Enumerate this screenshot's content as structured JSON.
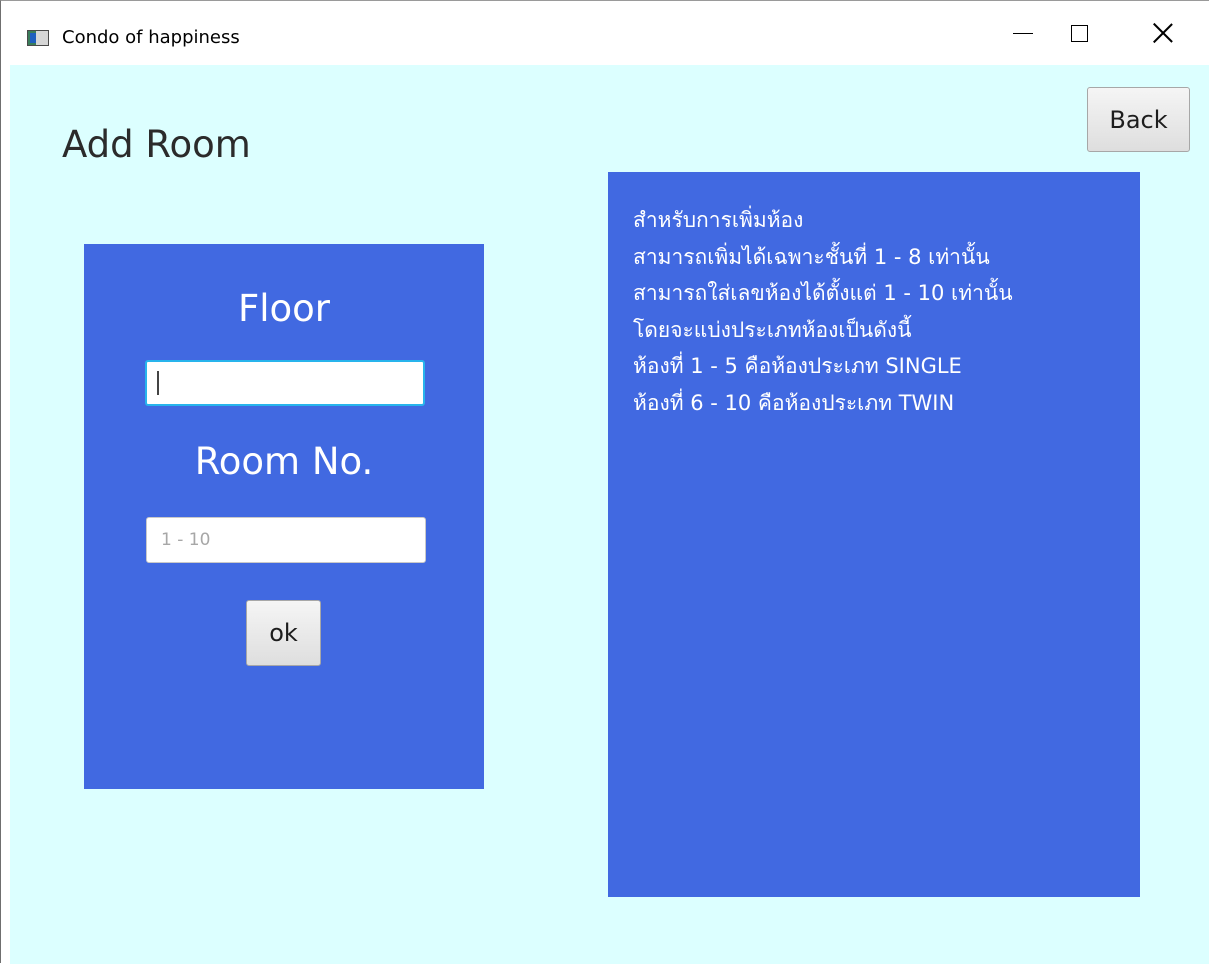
{
  "window": {
    "title": "Condo of happiness"
  },
  "page": {
    "title": "Add Room",
    "back_label": "Back"
  },
  "form": {
    "floor_label": "Floor",
    "floor_value": "",
    "room_label": "Room No.",
    "room_placeholder": "1 - 10",
    "ok_label": "ok"
  },
  "info": {
    "lines": [
      "สำหรับการเพิ่มห้อง",
      "สามารถเพิ่มได้เฉพาะชั้นที่ 1 - 8 เท่านั้น",
      "สามารถใส่เลขห้องได้ตั้งแต่ 1 - 10 เท่านั้น",
      "โดยจะแบ่งประเภทห้องเป็นดังนี้",
      "ห้องที่ 1 - 5 คือห้องประเภท SINGLE",
      "ห้องที่ 6 - 10 คือห้องประเภท TWIN"
    ]
  },
  "colors": {
    "background": "#dcffff",
    "panel": "#4169e1",
    "focus_border": "#28b4ec"
  },
  "icons": {
    "app": "app-window-icon",
    "minimize": "minimize-icon",
    "maximize": "maximize-icon",
    "close": "close-icon"
  }
}
